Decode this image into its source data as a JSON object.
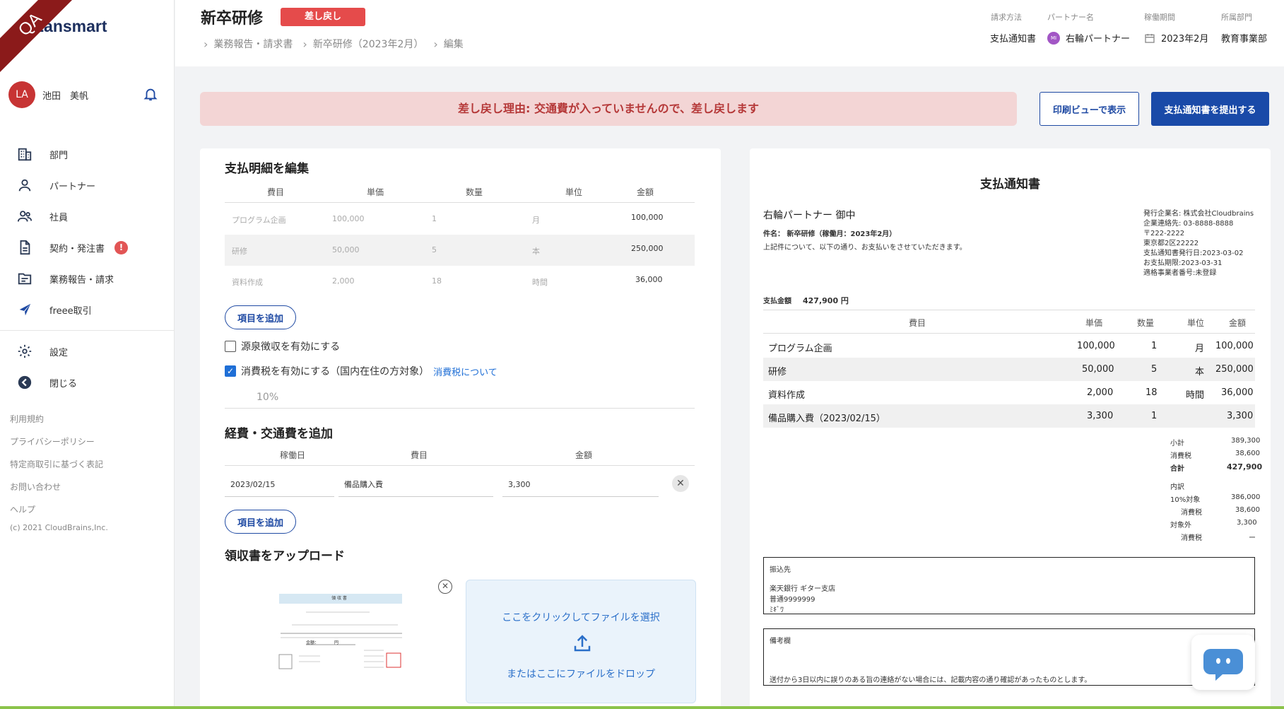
{
  "sidebar": {
    "ribbon": "QA",
    "logo": "Lansmart",
    "user": {
      "initials": "LA",
      "name": "池田　美帆"
    },
    "nav": [
      {
        "label": "部門",
        "icon": "building-icon"
      },
      {
        "label": "パートナー",
        "icon": "person-icon"
      },
      {
        "label": "社員",
        "icon": "people-icon"
      },
      {
        "label": "契約・発注書",
        "icon": "document-icon",
        "badge": "!"
      },
      {
        "label": "業務報告・請求",
        "icon": "folder-icon"
      },
      {
        "label": "freee取引",
        "icon": "freee-icon"
      }
    ],
    "nav2": [
      {
        "label": "設定",
        "icon": "gear-icon"
      },
      {
        "label": "閉じる",
        "icon": "back-arrow-icon"
      }
    ],
    "footer_links": [
      "利用規約",
      "プライバシーポリシー",
      "特定商取引に基づく表記",
      "お問い合わせ",
      "ヘルプ"
    ],
    "copyright": "(c) 2021 CloudBrains,Inc."
  },
  "header": {
    "title": "新卒研修",
    "status": "差し戻し",
    "breadcrumb": [
      "業務報告・請求書",
      "新卒研修（2023年2月）",
      "編集"
    ],
    "meta": {
      "method_label": "請求方法",
      "method_value": "支払通知書",
      "partner_label": "パートナー名",
      "partner_initials": "MI",
      "partner_value": "右輪パートナー",
      "period_label": "稼働期間",
      "period_value": "2023年2月",
      "dept_label": "所属部門",
      "dept_value": "教育事業部"
    }
  },
  "banner": "差し戻し理由: 交通費が入っていませんので、差し戻します",
  "actions": {
    "print_view": "印刷ビューで表示",
    "submit": "支払通知書を提出する"
  },
  "edit": {
    "title": "支払明細を編集",
    "columns": [
      "費目",
      "単価",
      "数量",
      "単位",
      "金額"
    ],
    "rows": [
      {
        "item": "プログラム企画",
        "price": "100,000",
        "qty": "1",
        "unit": "月",
        "amount": "100,000"
      },
      {
        "item": "研修",
        "price": "50,000",
        "qty": "5",
        "unit": "本",
        "amount": "250,000"
      },
      {
        "item": "資料作成",
        "price": "2,000",
        "qty": "18",
        "unit": "時間",
        "amount": "36,000"
      }
    ],
    "add_item": "項目を追加",
    "withholding": "源泉徴収を有効にする",
    "consumption_tax": "消費税を有効にする（国内在住の方対象）",
    "tax_link": "消費税について",
    "tax_rate": "10%"
  },
  "expenses": {
    "title": "経費・交通費を追加",
    "columns": [
      "稼働日",
      "費目",
      "金額"
    ],
    "row": {
      "date": "2023/02/15",
      "item": "備品購入費",
      "amount": "3,300"
    },
    "add_item": "項目を追加"
  },
  "receipt": {
    "title": "領収書をアップロード",
    "thumb_title": "領 収 書",
    "thumb_amount_label": "金額：",
    "thumb_amount": "円",
    "drop_top": "ここをクリックしてファイルを選択",
    "drop_bottom": "またはここにファイルをドロップ"
  },
  "preview": {
    "title": "支払通知書",
    "recipient": "右輪パートナー 御中",
    "subject": "件名： 新卒研修（稼働月：2023年2月）",
    "intro": "上記件について、以下の通り、お支払いをさせていただきます。",
    "issuer": [
      "発行企業名: 株式会社Cloudbrains",
      "企業連絡先: 03-8888-8888",
      "〒222-2222",
      "東京都2区22222",
      "支払通知書発行日:2023-03-02",
      "お支払期限:2023-03-31",
      "適格事業者番号:未登録"
    ],
    "total_label": "支払金額",
    "total_value": "427,900 円",
    "columns": [
      "費目",
      "単価",
      "数量",
      "単位",
      "金額"
    ],
    "rows": [
      {
        "item": "プログラム企画",
        "price": "100,000",
        "qty": "1",
        "unit": "月",
        "amount": "100,000"
      },
      {
        "item": "研修",
        "price": "50,000",
        "qty": "5",
        "unit": "本",
        "amount": "250,000"
      },
      {
        "item": "資料作成",
        "price": "2,000",
        "qty": "18",
        "unit": "時間",
        "amount": "36,000"
      },
      {
        "item": "備品購入費（2023/02/15）",
        "price": "3,300",
        "qty": "1",
        "unit": "",
        "amount": "3,300"
      }
    ],
    "summary": {
      "subtotal_label": "小計",
      "subtotal": "389,300",
      "tax_label": "消費税",
      "tax": "38,600",
      "total_label": "合計",
      "total": "427,900",
      "breakdown_label": "内訳",
      "taxable_label": "10%対象",
      "taxable": "386,000",
      "taxable_tax_label": "消費税",
      "taxable_tax": "38,600",
      "exempt_label": "対象外",
      "exempt": "3,300",
      "exempt_tax_label": "消費税",
      "exempt_tax": "ー"
    },
    "bank": {
      "label": "振込先",
      "lines": [
        "楽天銀行 ギター支店",
        "普通9999999",
        "ﾐｷﾞﾜ"
      ]
    },
    "remarks": {
      "label": "備考欄",
      "text": "送付から3日以内に誤りのある旨の連絡がない場合には、記載内容の通り確認があったものとします。"
    }
  }
}
